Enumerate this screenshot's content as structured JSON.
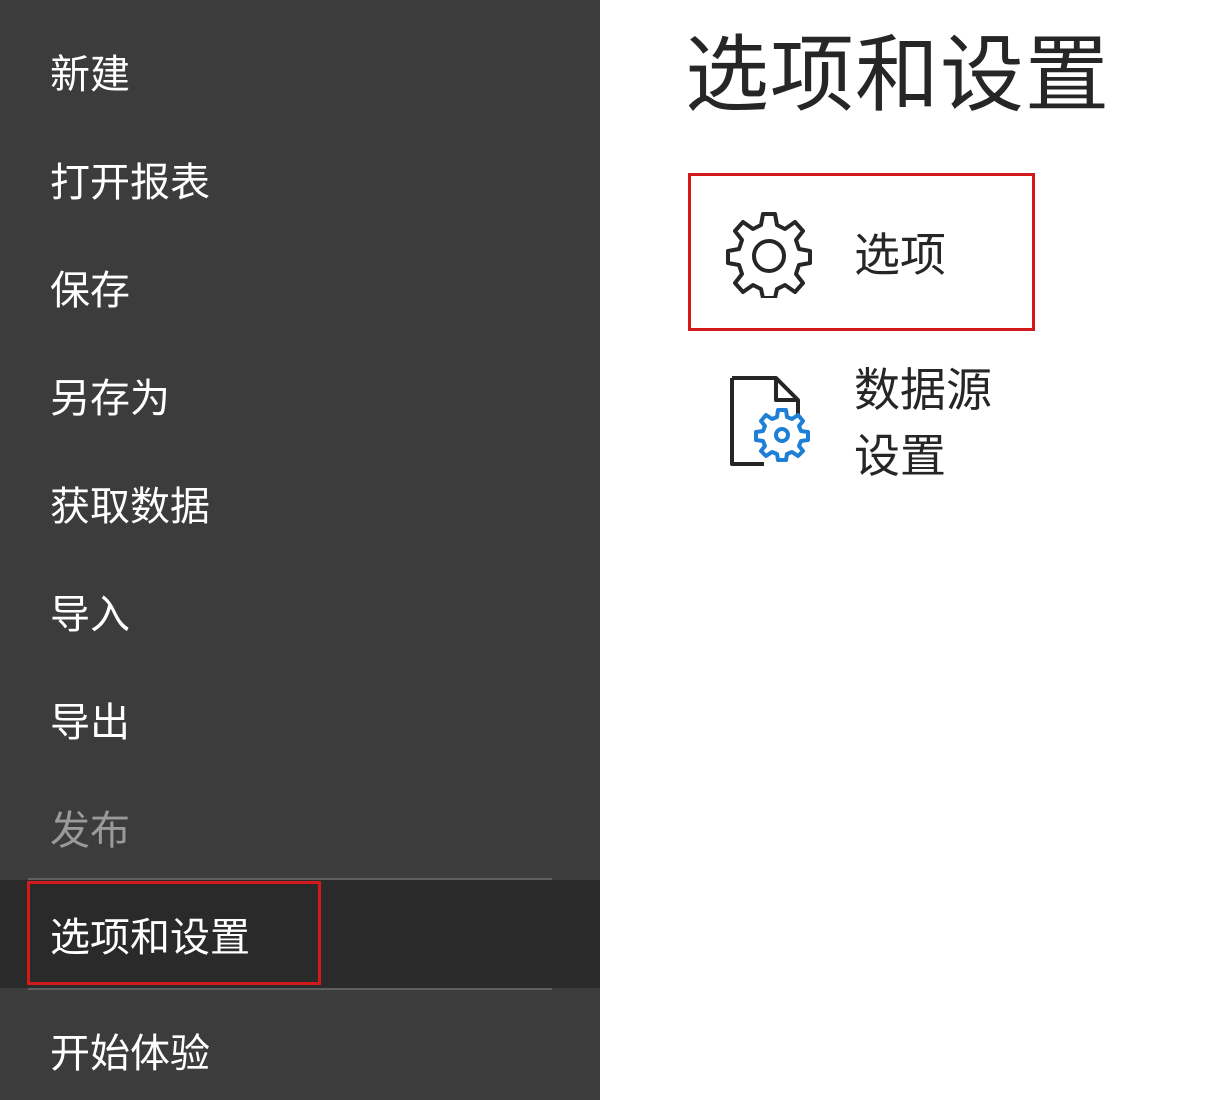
{
  "sidebar": {
    "items": [
      {
        "label": "新建",
        "state": "normal"
      },
      {
        "label": "打开报表",
        "state": "normal"
      },
      {
        "label": "保存",
        "state": "normal"
      },
      {
        "label": "另存为",
        "state": "normal"
      },
      {
        "label": "获取数据",
        "state": "normal"
      },
      {
        "label": "导入",
        "state": "normal"
      },
      {
        "label": "导出",
        "state": "normal"
      },
      {
        "label": "发布",
        "state": "disabled"
      },
      {
        "label": "选项和设置",
        "state": "selected"
      },
      {
        "label": "开始体验",
        "state": "normal"
      }
    ]
  },
  "main": {
    "title": "选项和设置",
    "options": [
      {
        "label": "选项",
        "icon": "gear-icon"
      },
      {
        "label": "数据源设置",
        "icon": "data-source-settings-icon"
      }
    ]
  },
  "colors": {
    "sidebar_bg": "#3c3c3c",
    "selected_bg": "#2a2a2a",
    "highlight_border": "#d21a1a",
    "accent_blue": "#1e7fd6",
    "disabled_text": "#9a9a9a"
  }
}
